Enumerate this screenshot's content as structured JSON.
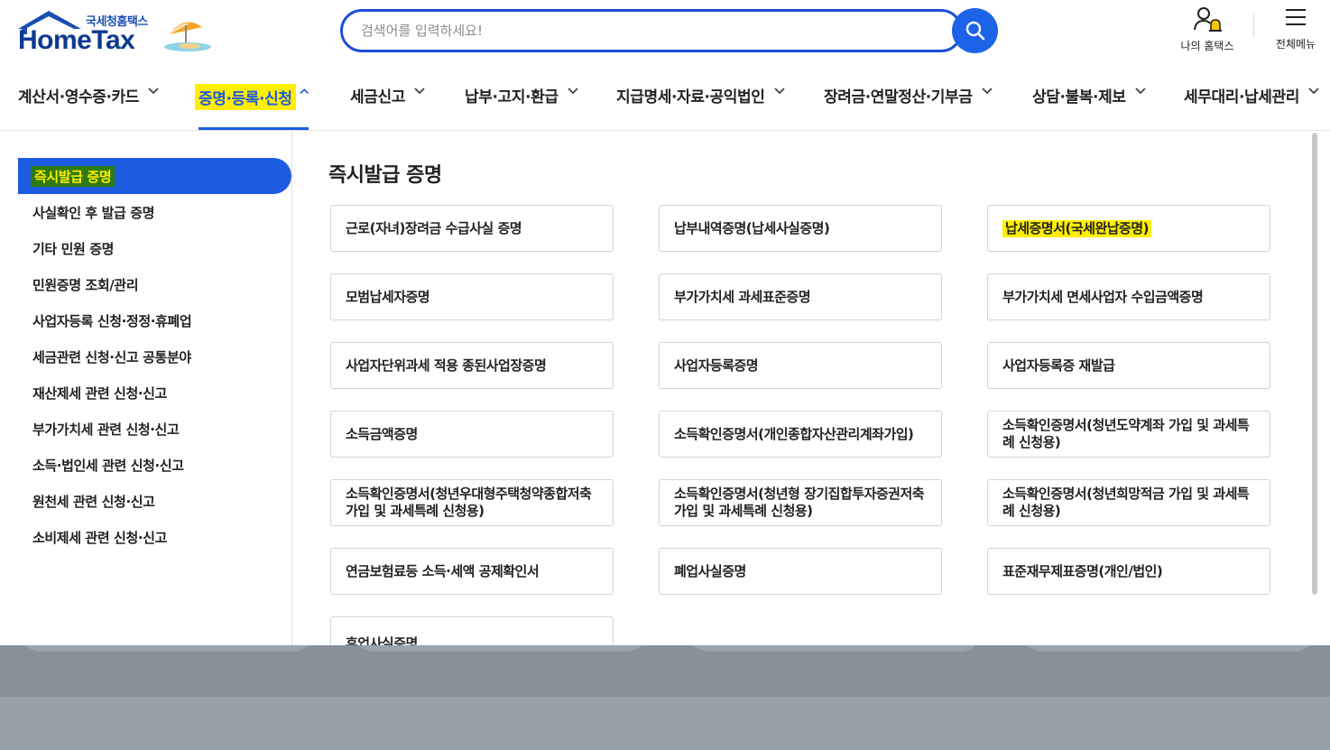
{
  "header": {
    "logo_sub": "국세청홈택스",
    "logo_main": "HomeTax",
    "search_placeholder": "검색어를 입력하세요!",
    "my_hometax_label": "나의 홈택스",
    "all_menu_label": "전체메뉴"
  },
  "nav": {
    "items": [
      {
        "label": "계산서·영수증·카드",
        "chevron": "down"
      },
      {
        "label": "증명·등록·신청",
        "chevron": "up",
        "active": true
      },
      {
        "label": "세금신고",
        "chevron": "down"
      },
      {
        "label": "납부·고지·환급",
        "chevron": "down"
      },
      {
        "label": "지급명세·자료·공익법인",
        "chevron": "down"
      },
      {
        "label": "장려금·연말정산·기부금",
        "chevron": "down"
      },
      {
        "label": "상담·불복·제보",
        "chevron": "down"
      },
      {
        "label": "세무대리·납세관리",
        "chevron": "down"
      }
    ]
  },
  "side_menu": {
    "active": "즉시발급 증명",
    "items": [
      "사실확인 후 발급 증명",
      "기타 민원 증명",
      "민원증명 조회/관리",
      "사업자등록 신청·정정·휴폐업",
      "세금관련 신청·신고 공통분야",
      "재산제세 관련 신청·신고",
      "부가가치세 관련 신청·신고",
      "소득·법인세 관련 신청·신고",
      "원천세 관련 신청·신고",
      "소비제세 관련 신청·신고"
    ]
  },
  "content": {
    "title": "즉시발급 증명",
    "certificates": [
      [
        "근로(자녀)장려금 수급사실 증명",
        "납부내역증명(납세사실증명)",
        "납세증명서(국세완납증명)"
      ],
      [
        "모범납세자증명",
        "부가가치세 과세표준증명",
        "부가가치세 면세사업자 수입금액증명"
      ],
      [
        "사업자단위과세 적용 종된사업장증명",
        "사업자등록증명",
        "사업자등록증 재발급"
      ],
      [
        "소득금액증명",
        "소득확인증명서(개인종합자산관리계좌가입)",
        "소득확인증명서(청년도약계좌 가입 및 과세특례 신청용)"
      ],
      [
        "소득확인증명서(청년우대형주택청약종합저축 가입 및 과세특례 신청용)",
        "소득확인증명서(청년형 장기집합투자증권저축 가입 및 과세특례 신청용)",
        "소득확인증명서(청년희망적금 가입 및 과세특례 신청용)"
      ],
      [
        "연금보험료등 소득·세액 공제확인서",
        "폐업사실증명",
        "표준재무제표증명(개인/법인)"
      ],
      [
        "휴업사실증명"
      ]
    ],
    "highlighted": "납세증명서(국세완납증명)"
  },
  "colors": {
    "brand_blue": "#1d5be0",
    "highlight_yellow": "#ffee00",
    "logo_navy": "#0c3a92"
  }
}
